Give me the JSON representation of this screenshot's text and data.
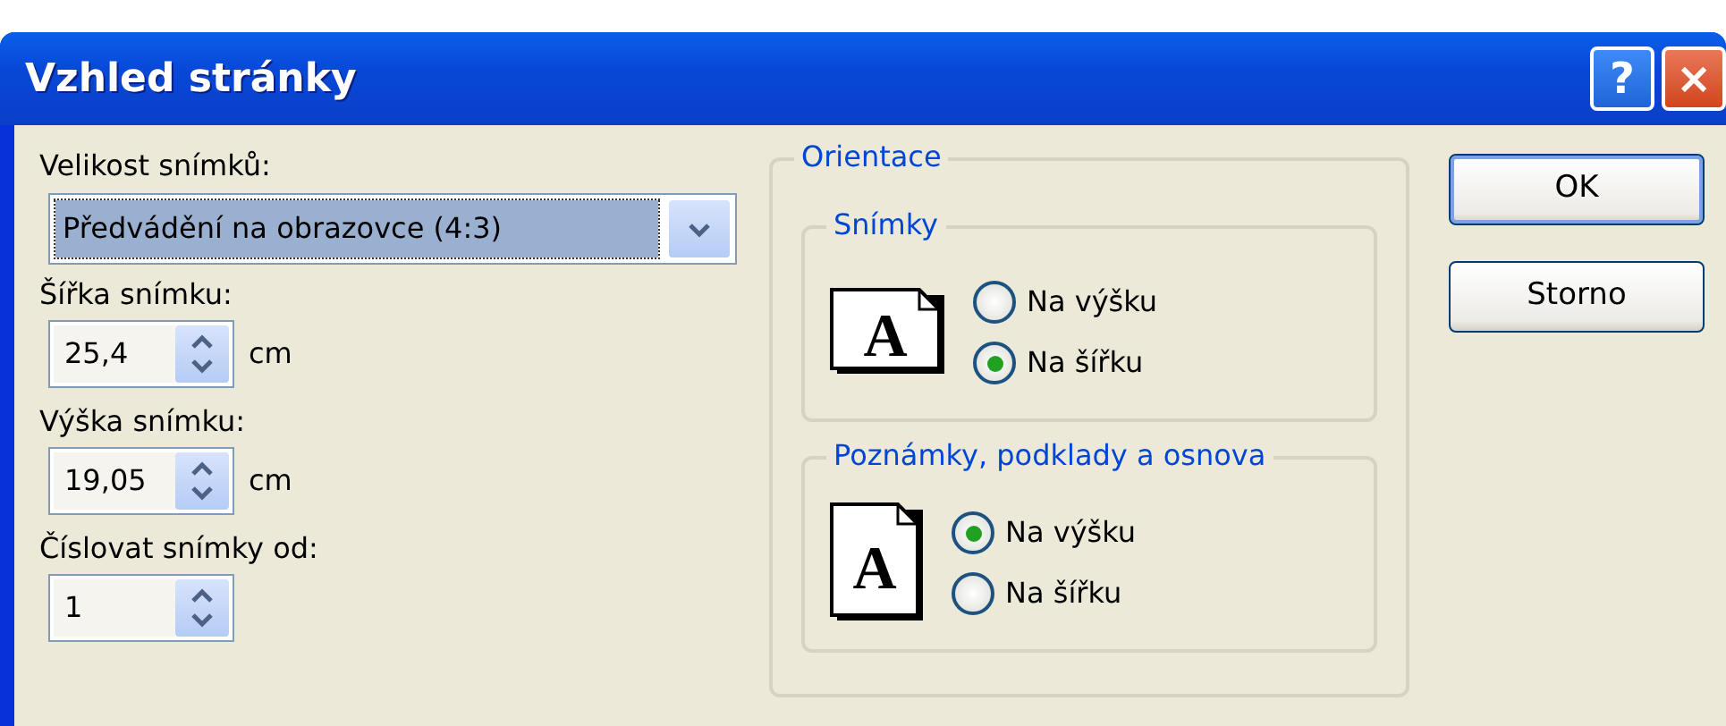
{
  "window": {
    "title": "Vzhled stránky",
    "buttons": [
      "?",
      "×"
    ]
  },
  "slide_size": {
    "label": "Velikost snímků:",
    "value": "Předvádění na obrazovce (4:3)"
  },
  "spinners": [
    {
      "label": "Šířka snímku:",
      "value": "25,4",
      "unit": "cm"
    },
    {
      "label": "Výška snímku:",
      "value": "19,05",
      "unit": "cm"
    },
    {
      "label": "Číslovat snímky od:",
      "value": "1"
    }
  ],
  "orientation": {
    "title": "Orientace",
    "groups": [
      {
        "title": "Snímky",
        "kind": "landscape",
        "icon_letter": "A",
        "options": [
          {
            "label": "Na výšku",
            "selected": false
          },
          {
            "label": "Na šířku",
            "selected": true
          }
        ]
      },
      {
        "title": "Poznámky, podklady a osnova",
        "kind": "portrait",
        "icon_letter": "A",
        "options": [
          {
            "label": "Na výšku",
            "selected": true
          },
          {
            "label": "Na šířku",
            "selected": false
          }
        ]
      }
    ]
  },
  "actions": [
    {
      "label": "OK",
      "default": true
    },
    {
      "label": "Storno",
      "default": false
    }
  ]
}
